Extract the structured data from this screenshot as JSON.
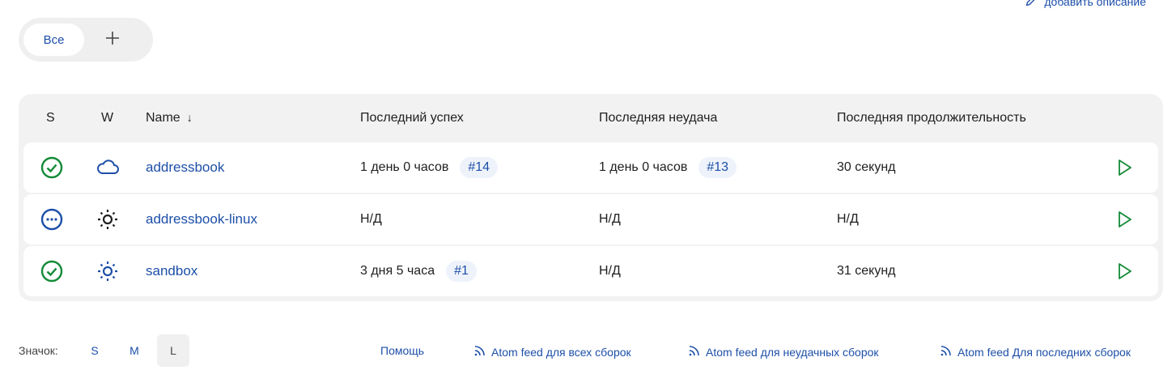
{
  "header": {
    "add_description_label": "добавить описание"
  },
  "view_tabs": {
    "active_label": "Все"
  },
  "table": {
    "columns": {
      "status": "S",
      "weather": "W",
      "name": "Name",
      "name_sort_arrow": "↓",
      "last_success": "Последний успех",
      "last_failure": "Последняя неудача",
      "last_duration": "Последняя продолжительность"
    },
    "rows": [
      {
        "status": "success",
        "weather": "cloudy",
        "name": "addressbook",
        "last_success": "1 день 0 часов",
        "last_success_build": "#14",
        "last_failure": "1 день 0 часов",
        "last_failure_build": "#13",
        "last_duration": "30 секунд"
      },
      {
        "status": "not-built",
        "weather": "sunny",
        "name": "addressbook-linux",
        "last_success": "Н/Д",
        "last_failure": "Н/Д",
        "last_duration": "Н/Д"
      },
      {
        "status": "success",
        "weather": "sunny",
        "name": "sandbox",
        "last_success": "3 дня 5 часа",
        "last_success_build": "#1",
        "last_failure": "Н/Д",
        "last_duration": "31 секунд"
      }
    ]
  },
  "footer": {
    "icon_size_label": "Значок:",
    "sizes": [
      "S",
      "M",
      "L"
    ],
    "selected_size": "L",
    "links": {
      "help": "Помощь",
      "atom_all": "Atom feed для всех сборок",
      "atom_failed": "Atom feed для неудачных сборок",
      "atom_latest": "Atom feed Для последних сборок"
    }
  },
  "colors": {
    "link": "#1d4fa8",
    "success": "#138a36",
    "not_built": "#1d4fa8",
    "panel_bg": "#f2f2f2"
  }
}
